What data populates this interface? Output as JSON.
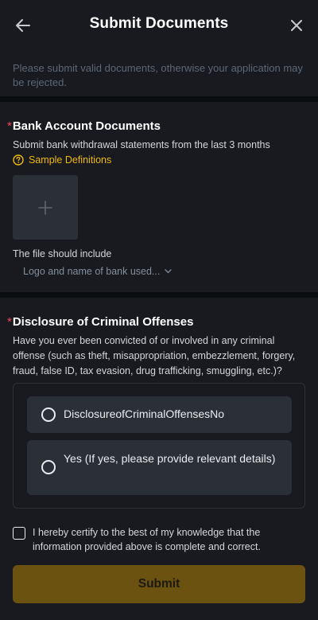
{
  "header": {
    "title": "Submit Documents",
    "back_icon": "arrow-left-icon",
    "close_icon": "close-icon"
  },
  "notice": "Please submit valid documents, otherwise your application may be rejected.",
  "bank_section": {
    "required_marker": "*",
    "title": "Bank Account Documents",
    "description": "Submit bank withdrawal statements from the last 3 months",
    "sample_link": "Sample Definitions",
    "sample_icon": "help-circle-icon",
    "upload_icon": "plus-icon",
    "file_include_label": "The file should include",
    "file_hint": "Logo and name of bank used...",
    "file_hint_icon": "chevron-down-icon"
  },
  "criminal_section": {
    "required_marker": "*",
    "title": "Disclosure of Criminal Offenses",
    "question": "Have you ever been convicted of or involved in any criminal offense (such as theft, misappropriation, embezzlement, forgery, fraud, false ID, tax evasion, drug trafficking, smuggling, etc.)?",
    "options": [
      {
        "label": "DisclosureofCriminalOffensesNo"
      },
      {
        "label": "Yes (If yes, please provide relevant details)"
      }
    ]
  },
  "certify_text": "I hereby certify to the best of my knowledge that the information provided above is complete and correct.",
  "submit_label": "Submit",
  "colors": {
    "background": "#181a20",
    "accent": "#f0b90b",
    "required": "#f6465d",
    "submit_disabled": "#6b5210"
  }
}
